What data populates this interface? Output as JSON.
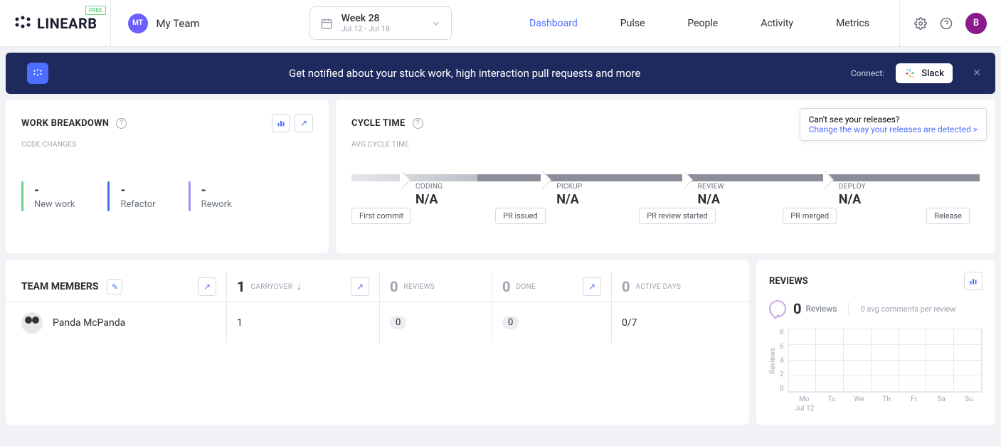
{
  "header": {
    "logo_text": "LINEARB",
    "free_badge": "FREE",
    "team_avatar": "MT",
    "team_name": "My Team",
    "week_title": "Week 28",
    "week_range": "Jul 12 - Jul 18",
    "nav": [
      "Dashboard",
      "Pulse",
      "People",
      "Activity",
      "Metrics"
    ],
    "user_initial": "B"
  },
  "banner": {
    "text": "Get notified about your stuck work, high interaction pull requests and more",
    "connect": "Connect:",
    "slack": "Slack"
  },
  "work_breakdown": {
    "title": "WORK BREAKDOWN",
    "subtitle": "CODE CHANGES",
    "metrics": [
      {
        "value": "-",
        "label": "New work"
      },
      {
        "value": "-",
        "label": "Refactor"
      },
      {
        "value": "-",
        "label": "Rework"
      }
    ]
  },
  "cycle_time": {
    "title": "CYCLE TIME",
    "subtitle": "AVG CYCLE TIME",
    "hint_line1": "Can't see your releases?",
    "hint_line2": "Change the way your releases are detected >",
    "stages": [
      {
        "label": "CODING",
        "value": "N/A"
      },
      {
        "label": "PICKUP",
        "value": "N/A"
      },
      {
        "label": "REVIEW",
        "value": "N/A"
      },
      {
        "label": "DEPLOY",
        "value": "N/A"
      }
    ],
    "markers": [
      "First commit",
      "PR issued",
      "PR review started",
      "PR merged",
      "Release"
    ]
  },
  "team_members": {
    "title": "TEAM MEMBERS",
    "cols": [
      {
        "num": "1",
        "label": "CARRYOVER",
        "muted": false
      },
      {
        "num": "0",
        "label": "REVIEWS",
        "muted": true
      },
      {
        "num": "0",
        "label": "DONE",
        "muted": true
      },
      {
        "num": "0",
        "label": "ACTIVE DAYS",
        "muted": true
      }
    ],
    "rows": [
      {
        "name": "Panda McPanda",
        "carryover": "1",
        "reviews": "0",
        "done": "0",
        "active": "0/7"
      }
    ]
  },
  "reviews": {
    "title": "REVIEWS",
    "count": "0",
    "count_label": "Reviews",
    "avg": "0 avg comments per review"
  },
  "chart_data": {
    "type": "bar",
    "title": "Reviews",
    "ylabel": "Reviews",
    "ylim": [
      0,
      8
    ],
    "yticks": [
      8,
      6,
      4,
      2,
      0
    ],
    "categories": [
      "Mo",
      "Tu",
      "We",
      "Th",
      "Fr",
      "Sa",
      "Su"
    ],
    "x_sublabel": "Jul 12",
    "values": [
      0,
      0,
      0,
      0,
      0,
      0,
      0
    ]
  }
}
